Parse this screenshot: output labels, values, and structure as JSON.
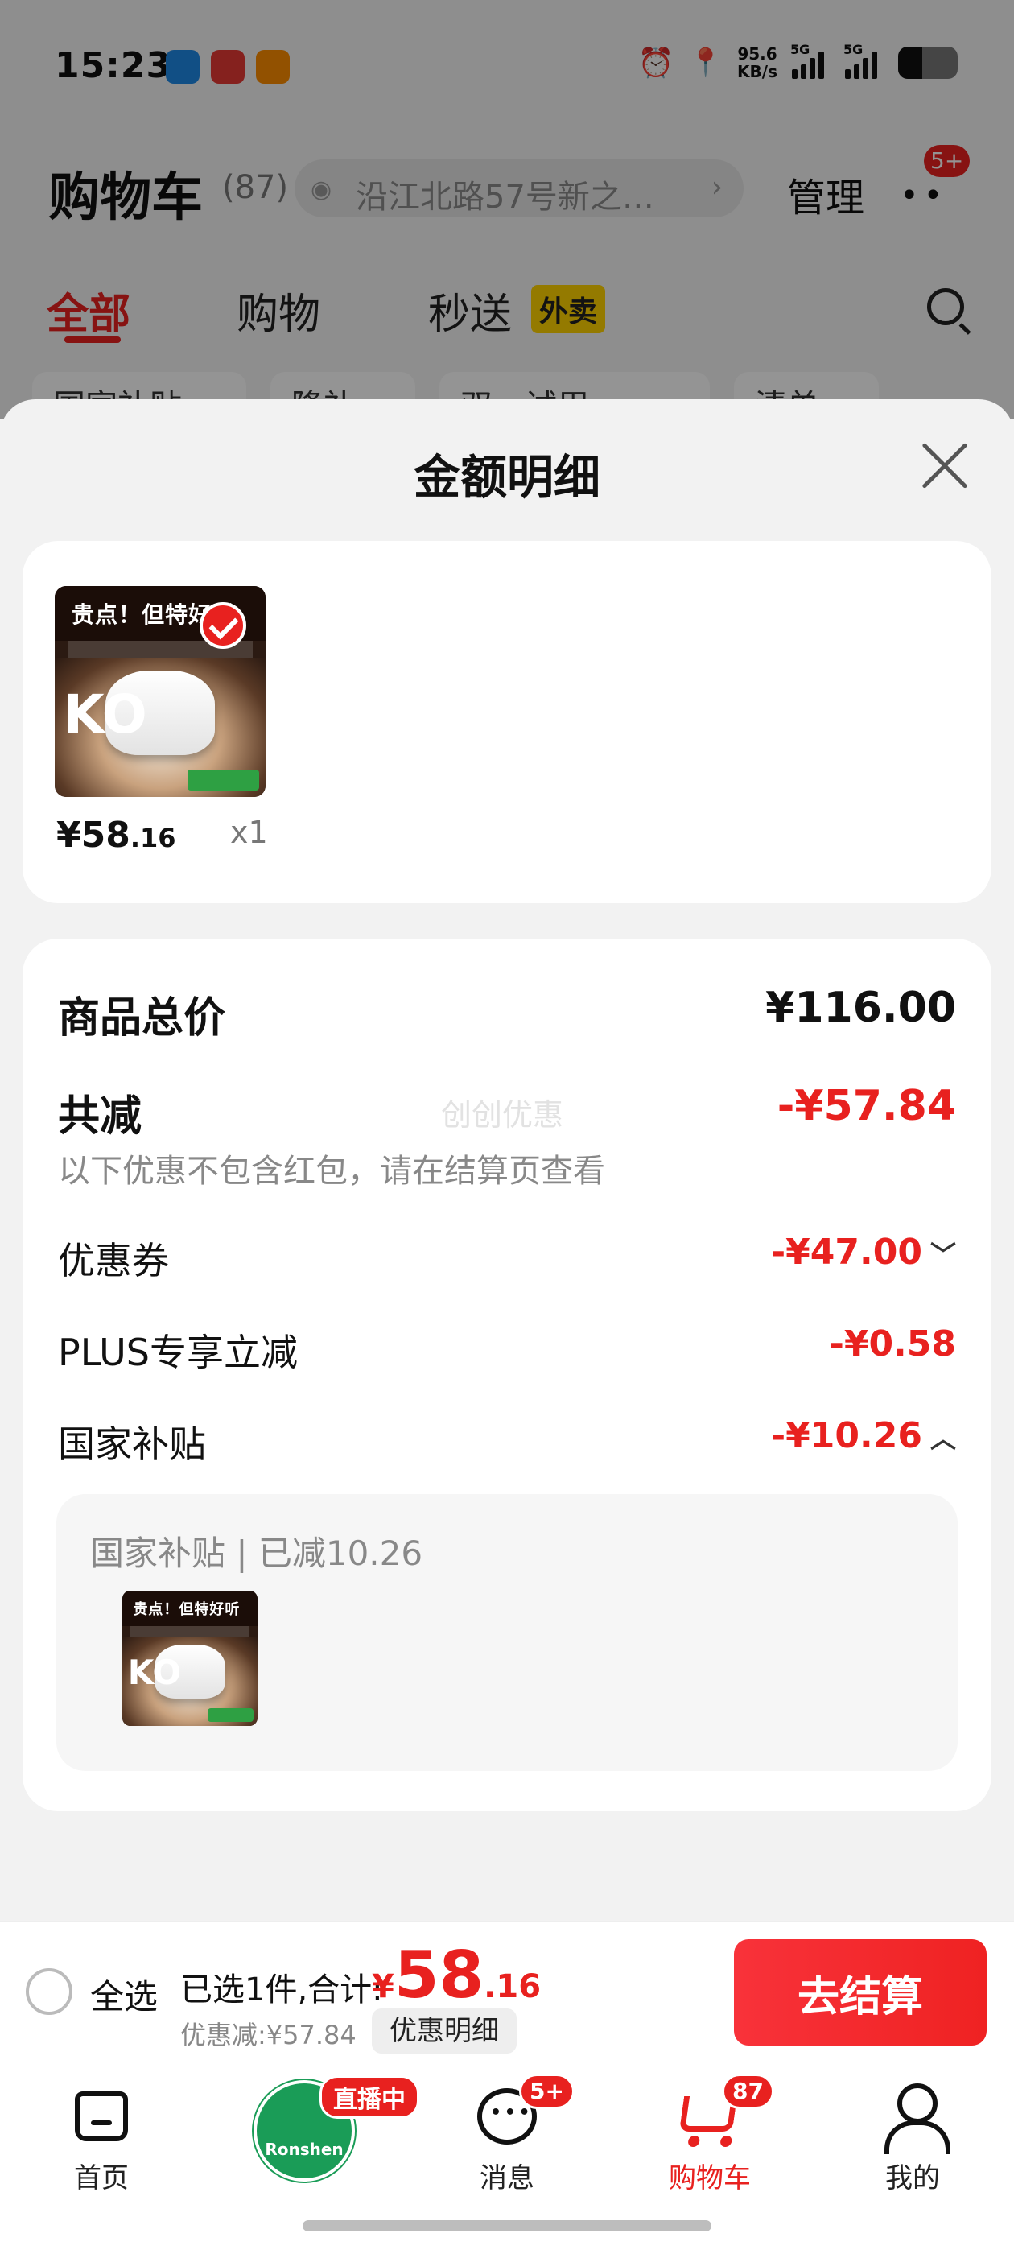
{
  "status_bar": {
    "time": "15:23",
    "apps": [
      {
        "icon": "app-icon-blue",
        "color": "#1e88e5",
        "text": ""
      },
      {
        "icon": "app-icon-red",
        "color": "#e53935",
        "text": ""
      },
      {
        "icon": "app-icon-orange",
        "color": "#fb8c00",
        "text": ""
      }
    ],
    "net_speed_value": "95.6",
    "net_speed_unit": "KB/s",
    "signal1_label": "5G",
    "signal2_label": "5G",
    "battery_level": 0.4
  },
  "header": {
    "title": "购物车",
    "count": "(87)",
    "address": "沿江北路57号新之…",
    "manage": "管理",
    "more_badge": "5+"
  },
  "tabs": {
    "items": [
      "全部",
      "购物",
      "秒送"
    ],
    "takeout_tag": "外卖",
    "active": "全部"
  },
  "filters": [
    "国家补贴",
    "降补",
    "双…试用",
    "清单"
  ],
  "sheet": {
    "title": "金额明细",
    "product": {
      "banner_text": "贵点！但特好听",
      "brand_text": "KO",
      "price_int": "¥58",
      "price_dec": ".16",
      "qty": "x1"
    },
    "summary": {
      "total_label": "商品总价",
      "total_value": "¥116.00",
      "minus_label": "共减",
      "minus_value": "-¥57.84",
      "note": "以下优惠不包含红包，请在结算页查看",
      "watermark": "创创优惠",
      "items": [
        {
          "label": "优惠券",
          "value": "-¥47.00",
          "caret": "﹀"
        },
        {
          "label": "PLUS专享立减",
          "value": "-¥0.58",
          "caret": ""
        },
        {
          "label": "国家补贴",
          "value": "-¥10.26",
          "caret": "︿"
        }
      ],
      "subsidy_detail": "国家补贴 | 已减10.26"
    }
  },
  "checkout": {
    "select_all": "全选",
    "selected_text": "已选1件,合计:",
    "currency": "¥",
    "total_int": "58",
    "total_dec": ".16",
    "discount_text": "优惠减:¥57.84",
    "detail_button": "优惠明细",
    "checkout_button": "去结算"
  },
  "bottom_nav": {
    "items": [
      {
        "label": "首页",
        "icon": "home-icon"
      },
      {
        "label": "",
        "icon": "live-stream-icon",
        "tag": "直播中",
        "logo_text": "Ronshen"
      },
      {
        "label": "消息",
        "icon": "message-icon",
        "badge": "5+"
      },
      {
        "label": "购物车",
        "icon": "cart-icon",
        "badge": "87"
      },
      {
        "label": "我的",
        "icon": "user-icon"
      }
    ],
    "active": "购物车"
  },
  "colors": {
    "accent": "#e8211f",
    "takeout": "#ffd200",
    "live_green": "#1a9c57"
  }
}
